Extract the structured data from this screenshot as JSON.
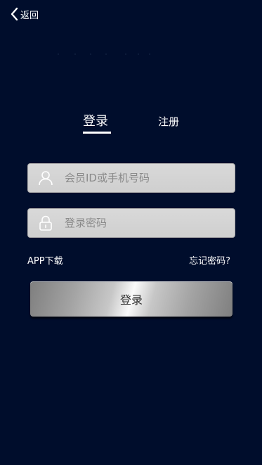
{
  "header": {
    "back_label": "返回",
    "back_icon": "chevron-left-icon"
  },
  "tabs": {
    "login": "登录",
    "register": "注册",
    "active": "login"
  },
  "form": {
    "account_placeholder": "会员ID或手机号码",
    "account_icon": "user-icon",
    "password_placeholder": "登录密码",
    "password_icon": "lock-icon"
  },
  "links": {
    "app_download": "APP下载",
    "forgot_password": "忘记密码?"
  },
  "submit_label": "登录",
  "colors": {
    "background": "#000d2c",
    "field": "#d4d4d4",
    "text": "#ffffff"
  }
}
